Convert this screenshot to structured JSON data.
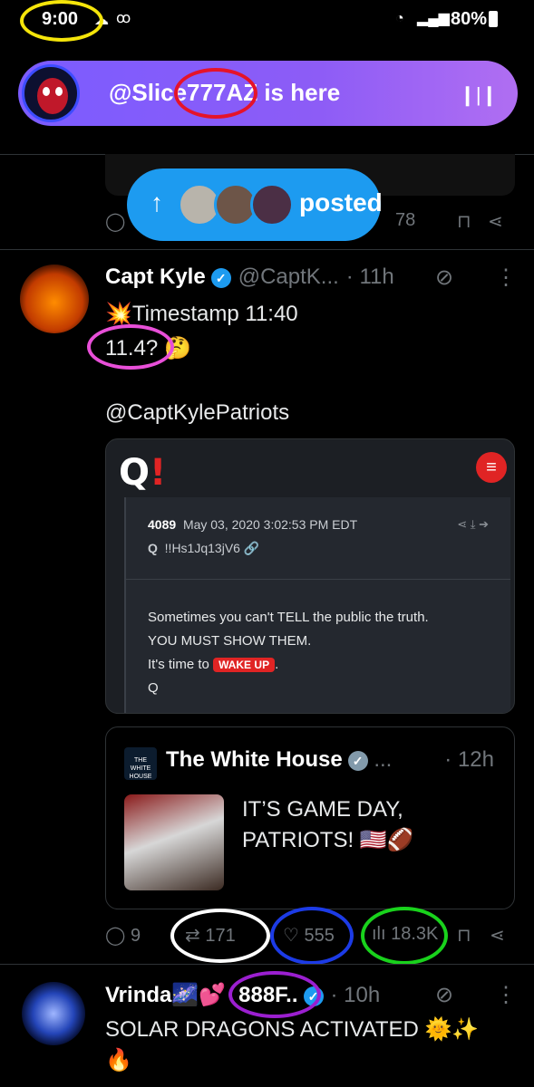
{
  "status_bar": {
    "time": "9:00",
    "battery": "80%",
    "icons": [
      "cloud-icon",
      "voicemail-icon",
      "wifi-icon",
      "signal-icon",
      "battery-icon"
    ]
  },
  "spaces_bar": {
    "label": "@Slice777AZ is here",
    "icon": "audio-wave-icon"
  },
  "posted_pill": {
    "label": "posted",
    "icon": "arrow-up-icon"
  },
  "top_partial": {
    "views": "78"
  },
  "post1": {
    "author": "Capt Kyle",
    "handle": "@CaptK...",
    "time": "· 11h",
    "line1": "Timestamp 11:40",
    "line2": "11.4? 🤔",
    "line3": "@CaptKylePatriots",
    "qcard": {
      "logo_q": "Q",
      "logo_bang": "!",
      "post_number": "4089",
      "date": "May 03, 2020 3:02:53 PM EDT",
      "author": "Q",
      "tripcode": "!!Hs1Jq13jV6",
      "msg_line1": "Sometimes you can't TELL the public the truth.",
      "msg_line2": "YOU MUST SHOW THEM.",
      "msg_line3_prefix": "It's time to",
      "wake_up": "WAKE UP",
      "msg_line3_suffix": ".",
      "msg_line4": "Q"
    },
    "quoted": {
      "author": "The White House",
      "more": "...",
      "time": "· 12h",
      "logo_text": "THE WHITE HOUSE",
      "text_line1": "IT’S GAME DAY,",
      "text_line2": "PATRIOTS! 🇺🇸🏈"
    },
    "stats": {
      "replies": "9",
      "reposts": "171",
      "likes": "555",
      "views": "18.3K"
    }
  },
  "post2": {
    "author": "Vrinda🌌💕",
    "handle": "888F..",
    "time": "· 10h",
    "text_line1": "SOLAR DRAGONS ACTIVATED 🌞✨",
    "text_line2": "🔥"
  },
  "annotation_colors": {
    "yellow": "#f5e50a",
    "red": "#e5132a",
    "pink": "#e84fd8",
    "white": "#ffffff",
    "blue": "#1c3be6",
    "green": "#19d21c",
    "purple": "#9b1fd0"
  }
}
